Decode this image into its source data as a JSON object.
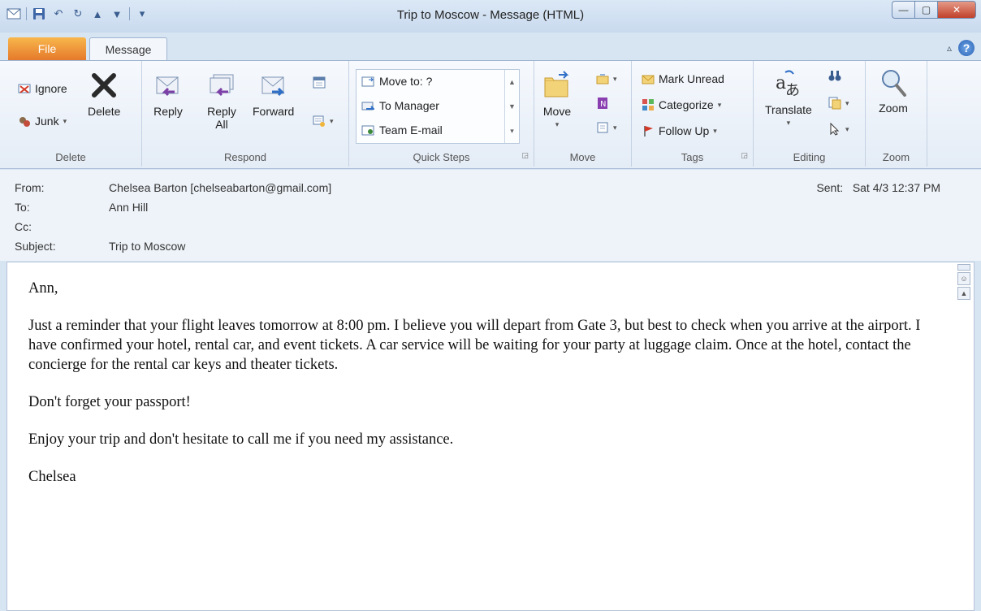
{
  "window": {
    "title": "Trip to Moscow - Message (HTML)"
  },
  "tabs": {
    "file": "File",
    "message": "Message"
  },
  "ribbon": {
    "delete_group": {
      "label": "Delete",
      "ignore": "Ignore",
      "junk": "Junk",
      "delete": "Delete"
    },
    "respond_group": {
      "label": "Respond",
      "reply": "Reply",
      "reply_all_1": "Reply",
      "reply_all_2": "All",
      "forward": "Forward"
    },
    "quicksteps_group": {
      "label": "Quick Steps",
      "items": [
        "Move to: ?",
        "To Manager",
        "Team E-mail"
      ]
    },
    "move_group": {
      "label": "Move",
      "move": "Move"
    },
    "tags_group": {
      "label": "Tags",
      "mark_unread": "Mark Unread",
      "categorize": "Categorize",
      "follow_up": "Follow Up"
    },
    "editing_group": {
      "label": "Editing",
      "translate": "Translate"
    },
    "zoom_group": {
      "label": "Zoom",
      "zoom": "Zoom"
    }
  },
  "header": {
    "from_label": "From:",
    "from_value": "Chelsea Barton [chelseabarton@gmail.com]",
    "to_label": "To:",
    "to_value": "Ann Hill",
    "cc_label": "Cc:",
    "subject_label": "Subject:",
    "subject_value": "Trip to Moscow",
    "sent_label": "Sent:",
    "sent_value": "Sat 4/3 12:37 PM"
  },
  "body": {
    "greeting": "Ann,",
    "paragraph1": "Just a reminder that your flight leaves tomorrow at 8:00 pm.  I believe you will depart from Gate 3, but best to check when you arrive at the airport.  I have confirmed your hotel, rental car, and event tickets.  A car service will be waiting for your party at luggage claim.  Once at the hotel, contact the concierge for the rental car keys and theater tickets.",
    "paragraph2": "Don't forget your passport!",
    "paragraph3": "Enjoy your trip and don't hesitate to call me if you need my assistance.",
    "signature": "Chelsea"
  },
  "colors": {
    "file_tab": "#e5792b",
    "ribbon_bg": "#f6f9fd",
    "close_button": "#c0412b"
  }
}
